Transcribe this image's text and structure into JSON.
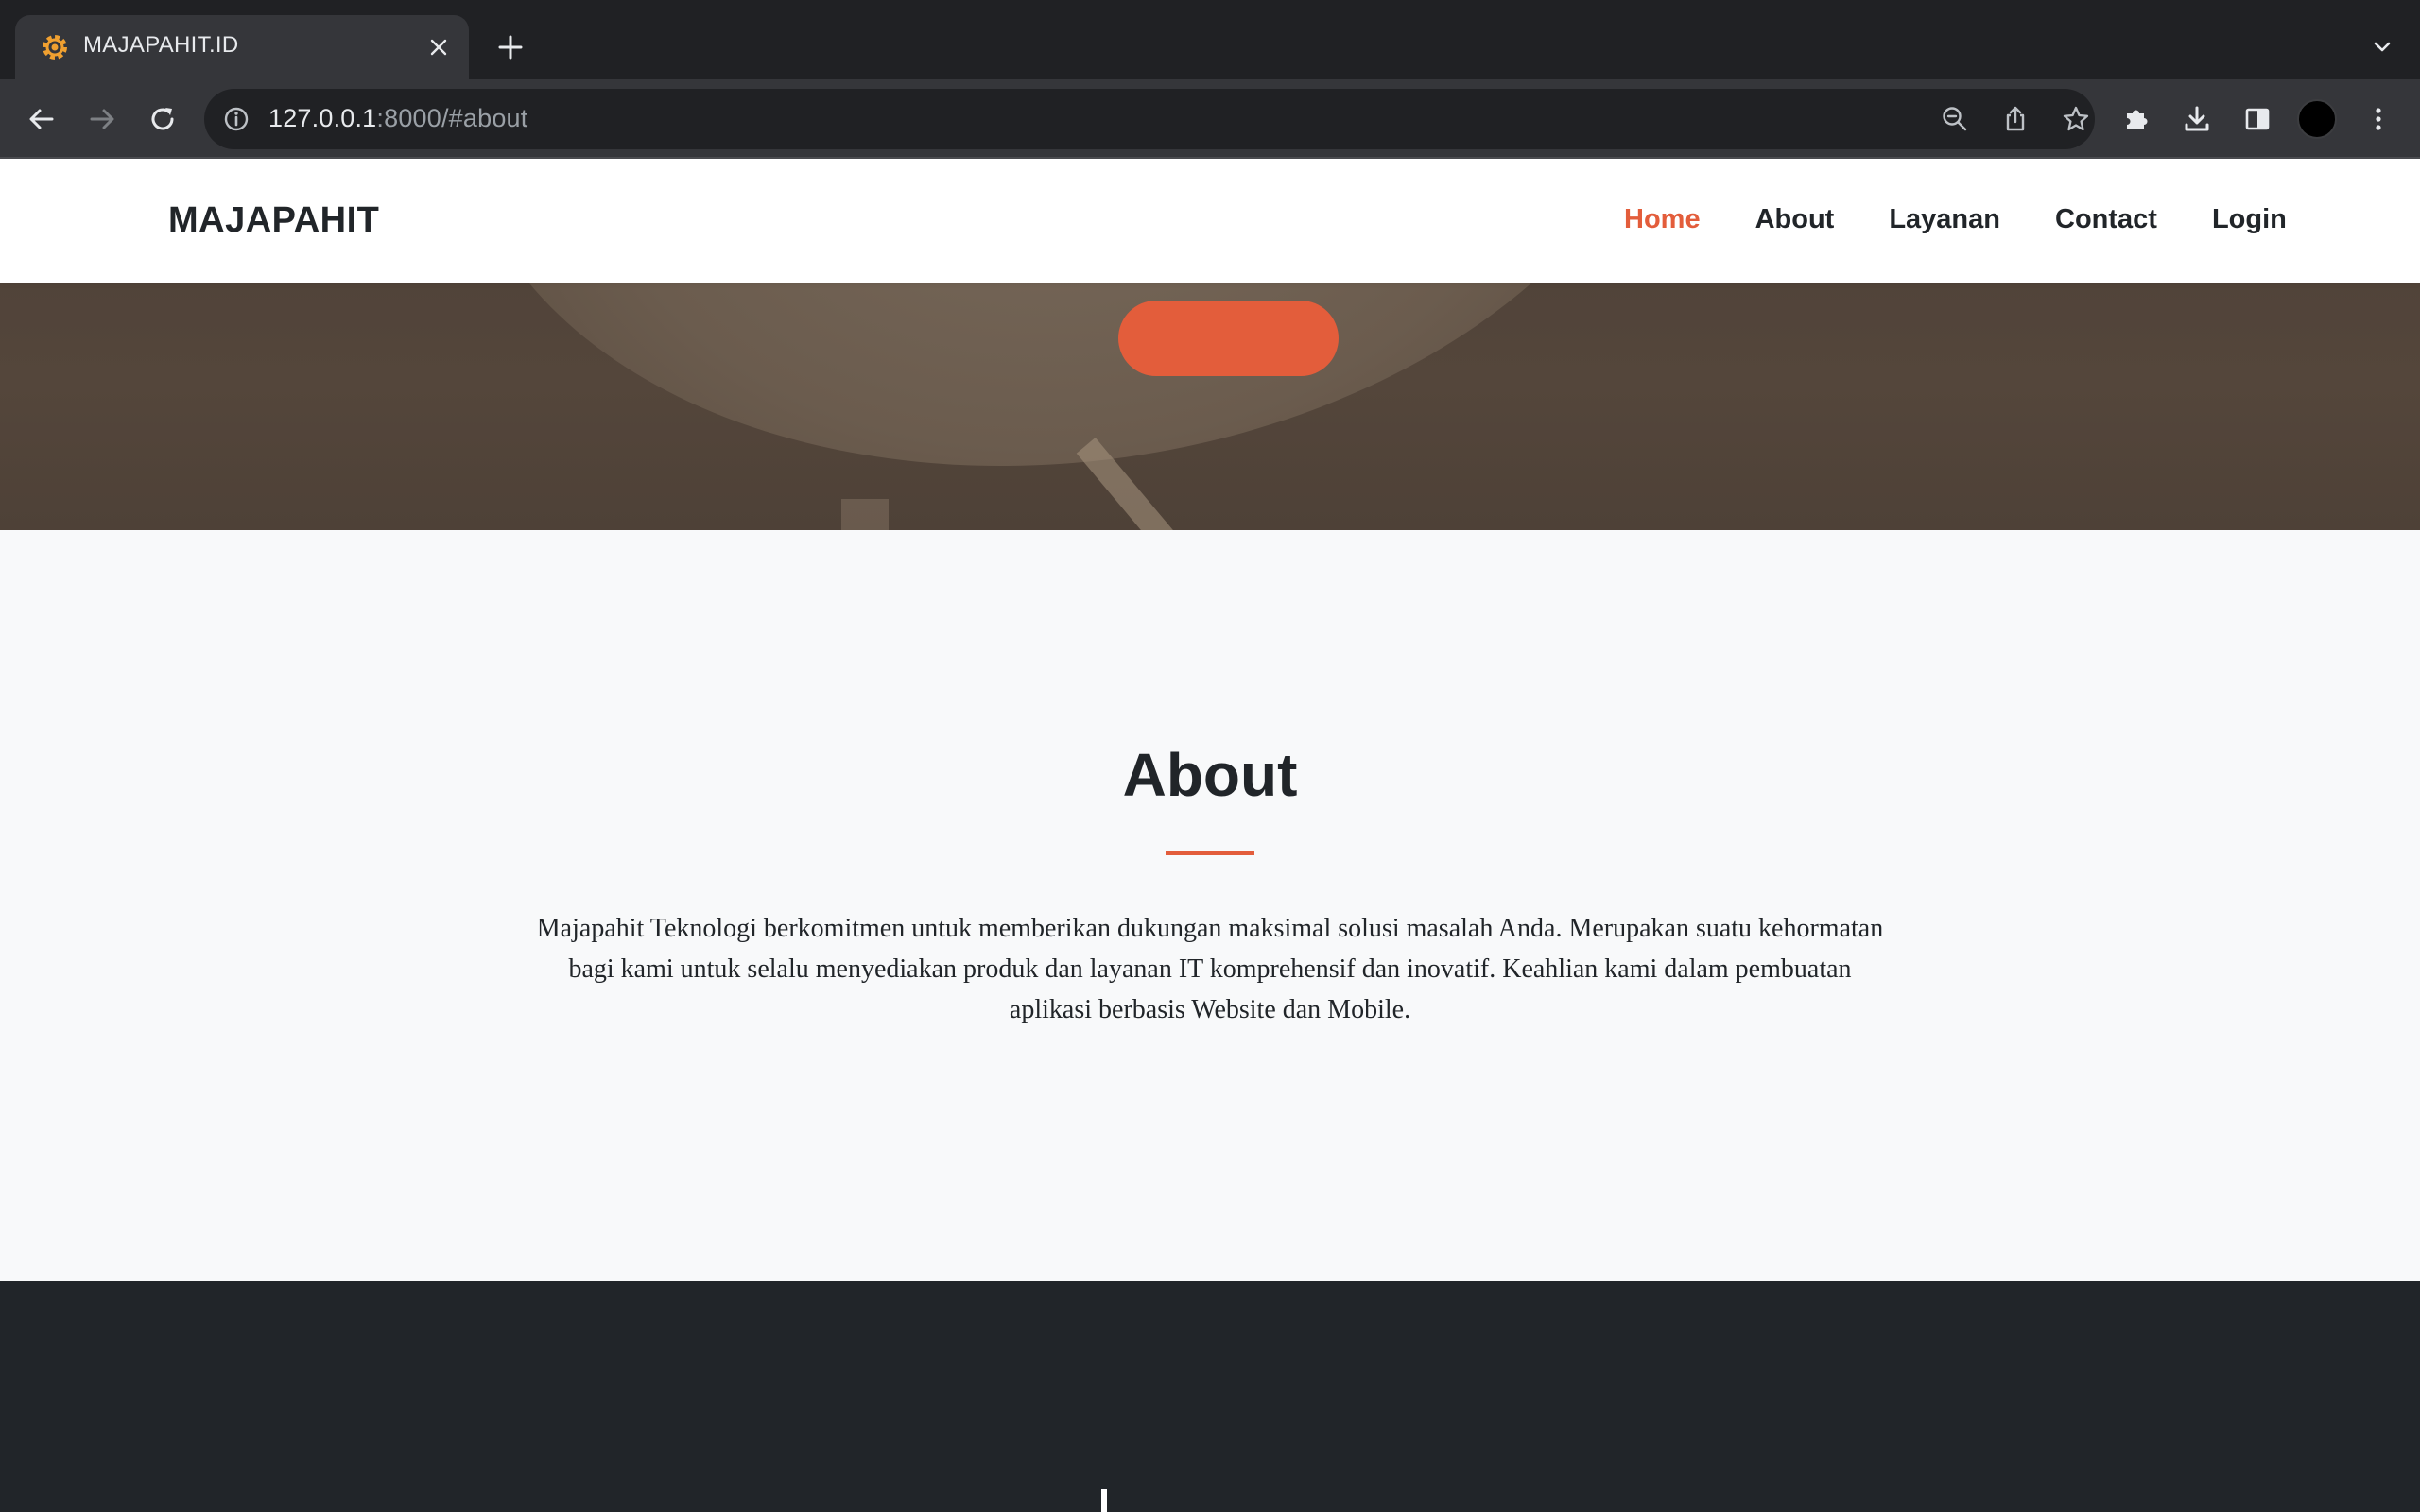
{
  "browser": {
    "tab": {
      "title": "MAJAPAHIT.ID",
      "favicon": "gear-icon"
    },
    "address": {
      "host": "127.0.0.1",
      "rest": ":8000/#about"
    }
  },
  "site": {
    "brand": "MAJAPAHIT",
    "nav": [
      {
        "label": "Home",
        "active": true
      },
      {
        "label": "About",
        "active": false
      },
      {
        "label": "Layanan",
        "active": false
      },
      {
        "label": "Contact",
        "active": false
      },
      {
        "label": "Login",
        "active": false
      }
    ],
    "about": {
      "title": "About",
      "body": "Majapahit Teknologi berkomitmen untuk memberikan dukungan maksimal solusi masalah Anda. Merupakan suatu kehormatan bagi kami untuk selalu menyediakan produk dan layanan IT komprehensif dan inovatif. Keahlian kami dalam pembuatan aplikasi berbasis Website dan Mobile."
    }
  },
  "colors": {
    "accent": "#e35d3b",
    "dark": "#212529",
    "light_bg": "#f8f9fa"
  }
}
